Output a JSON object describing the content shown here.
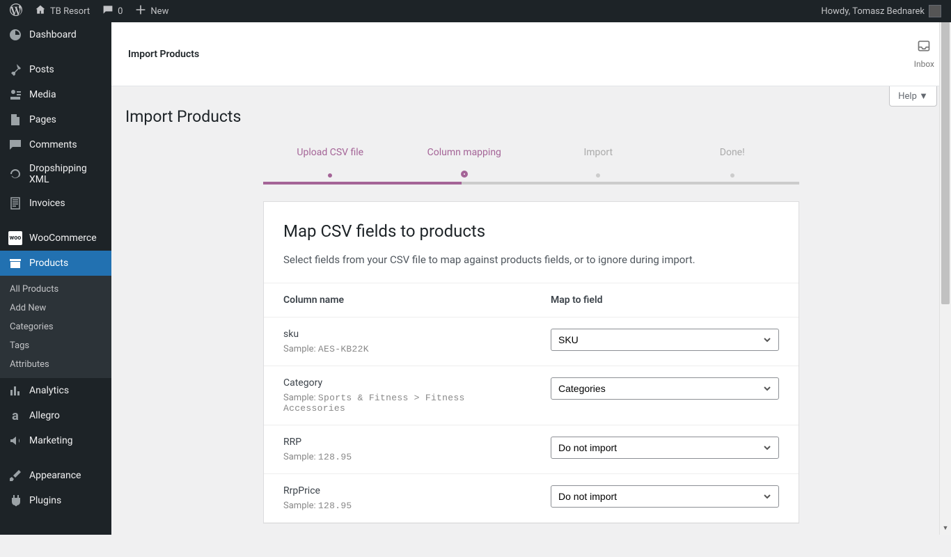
{
  "adminbar": {
    "site_name": "TB Resort",
    "comment_count": "0",
    "new_label": "New",
    "greeting": "Howdy, Tomasz Bednarek"
  },
  "sidebar": {
    "items": [
      {
        "icon": "dashboard",
        "label": "Dashboard"
      },
      {
        "icon": "pin",
        "label": "Posts"
      },
      {
        "icon": "media",
        "label": "Media"
      },
      {
        "icon": "page",
        "label": "Pages"
      },
      {
        "icon": "comment",
        "label": "Comments"
      },
      {
        "icon": "refresh",
        "label": "Dropshipping XML"
      },
      {
        "icon": "calc",
        "label": "Invoices"
      },
      {
        "icon": "woo",
        "label": "WooCommerce"
      },
      {
        "icon": "archive",
        "label": "Products"
      },
      {
        "icon": "chart",
        "label": "Analytics"
      },
      {
        "icon": "allegro",
        "label": "Allegro"
      },
      {
        "icon": "megaphone",
        "label": "Marketing"
      },
      {
        "icon": "brush",
        "label": "Appearance"
      },
      {
        "icon": "plugin",
        "label": "Plugins"
      }
    ],
    "submenu_products": [
      "All Products",
      "Add New",
      "Categories",
      "Tags",
      "Attributes"
    ]
  },
  "header": {
    "title": "Import Products",
    "inbox_label": "Inbox"
  },
  "help": "Help ▼",
  "page_title": "Import Products",
  "progress": {
    "steps": [
      "Upload CSV file",
      "Column mapping",
      "Import",
      "Done!"
    ]
  },
  "card": {
    "heading": "Map CSV fields to products",
    "desc": "Select fields from your CSV file to map against products fields, or to ignore during import."
  },
  "table": {
    "col_name_header": "Column name",
    "col_map_header": "Map to field",
    "sample_label": "Sample:",
    "rows": [
      {
        "name": "sku",
        "sample": "AES-KB22K",
        "mapped": "SKU"
      },
      {
        "name": "Category",
        "sample": "Sports & Fitness > Fitness Accessories",
        "mapped": "Categories"
      },
      {
        "name": "RRP",
        "sample": "128.95",
        "mapped": "Do not import"
      },
      {
        "name": "RrpPrice",
        "sample": "128.95",
        "mapped": "Do not import"
      }
    ]
  }
}
